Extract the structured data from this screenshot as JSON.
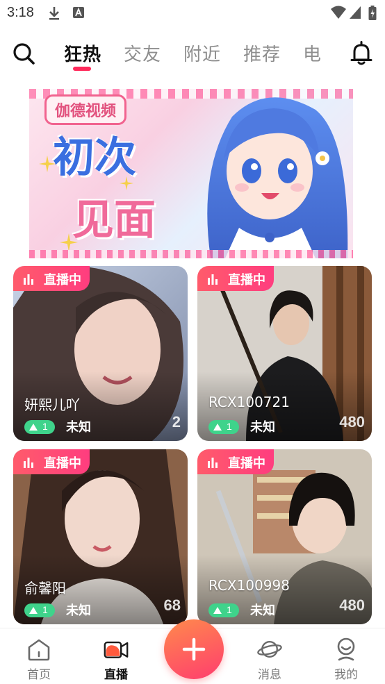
{
  "status_bar": {
    "time": "3:18"
  },
  "top_nav": {
    "tabs": [
      {
        "label": "狂热",
        "active": true
      },
      {
        "label": "交友",
        "active": false
      },
      {
        "label": "附近",
        "active": false
      },
      {
        "label": "推荐",
        "active": false
      },
      {
        "label": "电",
        "active": false
      }
    ],
    "accent": "#ff2a5b"
  },
  "banner": {
    "tag": "伽德视频",
    "line1": "初次",
    "line2": "见面"
  },
  "live_badge_label": "直播中",
  "cards": [
    {
      "name": "妍熙儿吖",
      "level": "1",
      "location": "未知",
      "viewers": "2"
    },
    {
      "name": "RCX100721",
      "level": "1",
      "location": "未知",
      "viewers": "480"
    },
    {
      "name": "俞馨阳",
      "level": "1",
      "location": "未知",
      "viewers": "68"
    },
    {
      "name": "RCX100998",
      "level": "1",
      "location": "未知",
      "viewers": "480"
    }
  ],
  "bottom_nav": {
    "items": [
      {
        "label": "首页",
        "icon": "home-icon",
        "active": false
      },
      {
        "label": "直播",
        "icon": "video-camera-icon",
        "active": true
      },
      {
        "label": "消息",
        "icon": "planet-icon",
        "active": false
      },
      {
        "label": "我的",
        "icon": "profile-icon",
        "active": false
      }
    ],
    "fab_icon": "plus-icon"
  },
  "colors": {
    "live_badge": "#ff3d7f",
    "level_pill": "#3fd38b",
    "fab_gradient_start": "#ff8a4c",
    "fab_gradient_end": "#ff3d6e"
  }
}
